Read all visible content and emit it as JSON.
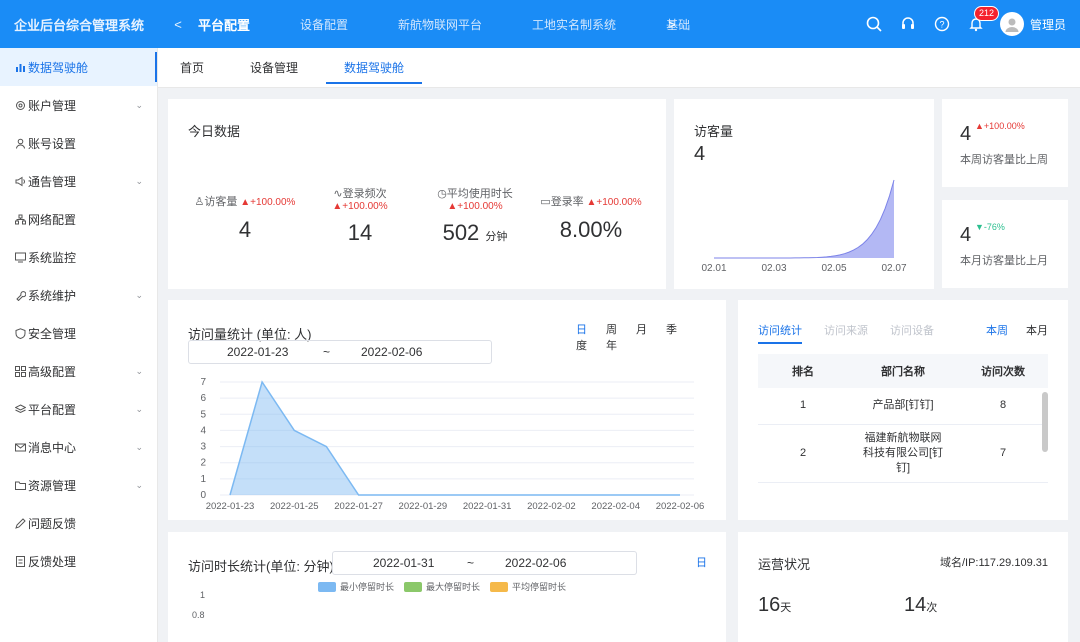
{
  "header": {
    "brand": "企业后台综合管理系统",
    "prev": "<",
    "next": ">",
    "nav": [
      "平台配置",
      "设备配置",
      "新航物联网平台",
      "工地实名制系统",
      "基础"
    ],
    "active_nav": 0,
    "notification_count": "212",
    "user_name": "管理员",
    "accent": "#1a8cf6"
  },
  "sidebar": {
    "items": [
      {
        "label": "数据驾驶舱",
        "icon": "bar-chart-icon",
        "active": true,
        "chevron": false
      },
      {
        "label": "账户管理",
        "icon": "gear-icon",
        "chevron": true
      },
      {
        "label": "账号设置",
        "icon": "user-icon",
        "chevron": false
      },
      {
        "label": "通告管理",
        "icon": "megaphone-icon",
        "chevron": true
      },
      {
        "label": "网络配置",
        "icon": "network-icon",
        "chevron": false
      },
      {
        "label": "系统监控",
        "icon": "monitor-icon",
        "chevron": false
      },
      {
        "label": "系统维护",
        "icon": "wrench-icon",
        "chevron": true
      },
      {
        "label": "安全管理",
        "icon": "shield-icon",
        "chevron": false
      },
      {
        "label": "高级配置",
        "icon": "grid-icon",
        "chevron": true
      },
      {
        "label": "平台配置",
        "icon": "layers-icon",
        "chevron": true
      },
      {
        "label": "消息中心",
        "icon": "mail-icon",
        "chevron": true
      },
      {
        "label": "资源管理",
        "icon": "folder-icon",
        "chevron": true
      },
      {
        "label": "问题反馈",
        "icon": "edit-icon",
        "chevron": false
      },
      {
        "label": "反馈处理",
        "icon": "document-icon",
        "chevron": false
      }
    ]
  },
  "tabs": [
    "首页",
    "设备管理",
    "数据驾驶舱"
  ],
  "today": {
    "title": "今日数据",
    "stats": [
      {
        "label": "访客量",
        "change": "+100.00%",
        "value": "4",
        "unit": ""
      },
      {
        "label": "登录频次",
        "change": "+100.00%",
        "value": "14",
        "unit": ""
      },
      {
        "label": "平均使用时长",
        "change": "+100.00%",
        "value": "502",
        "unit": "分钟"
      },
      {
        "label": "登录率",
        "change": "+100.00%",
        "value": "8.00%",
        "unit": ""
      }
    ]
  },
  "visitor": {
    "title": "访客量",
    "value": "4"
  },
  "mini_cards": [
    {
      "value": "4",
      "change": "+100.00%",
      "direction": "up",
      "desc": "本周访客量比上周"
    },
    {
      "value": "4",
      "change": "-76%",
      "direction": "down",
      "desc": "本月访客量比上月"
    }
  ],
  "visit_stats": {
    "title": "访问量统计 (单位: 人)",
    "range_start": "2022-01-23",
    "range_sep": "~",
    "range_end": "2022-02-06",
    "periods": [
      "日",
      "周",
      "月",
      "季",
      "度",
      "年"
    ]
  },
  "ranking": {
    "tabs": [
      "访问统计",
      "访问来源",
      "访问设备"
    ],
    "periods": [
      "本周",
      "本月"
    ],
    "headers": [
      "排名",
      "部门名称",
      "访问次数"
    ],
    "rows": [
      {
        "rank": "1",
        "dept": "产品部[钉钉]",
        "count": "8"
      },
      {
        "rank": "2",
        "dept": "福建新航物联网科技有限公司[钉钉]",
        "count": "7"
      }
    ]
  },
  "duration": {
    "title": "访问时长统计(单位: 分钟)",
    "range_start": "2022-01-31",
    "range_sep": "~",
    "range_end": "2022-02-06",
    "period": "日",
    "legend": [
      {
        "name": "最小停留时长",
        "color": "#7cb9f2"
      },
      {
        "name": "最大停留时长",
        "color": "#8bc86a"
      },
      {
        "name": "平均停留时长",
        "color": "#f5b94a"
      }
    ],
    "ticks": [
      "1",
      "0.8"
    ]
  },
  "ops": {
    "title": "运营状况",
    "domain": "域名/IP:117.29.109.31",
    "days": "16",
    "days_unit": "天",
    "times": "14",
    "times_unit": "次"
  },
  "chart_data": [
    {
      "type": "area",
      "x": [
        "02.01",
        "02.03",
        "02.05",
        "02.07"
      ],
      "values": [
        0,
        0,
        0,
        4
      ],
      "title": "",
      "color": "#9aa0f0"
    },
    {
      "type": "area",
      "categories": [
        "2022-01-23",
        "2022-01-24",
        "2022-01-25",
        "2022-01-26",
        "2022-01-27",
        "2022-01-28",
        "2022-01-29",
        "2022-01-30",
        "2022-01-31",
        "2022-02-01",
        "2022-02-02",
        "2022-02-03",
        "2022-02-04",
        "2022-02-05",
        "2022-02-06"
      ],
      "x_tick_labels": [
        "2022-01-23",
        "2022-01-25",
        "2022-01-27",
        "2022-01-29",
        "2022-01-31",
        "2022-02-02",
        "2022-02-04",
        "2022-02-06"
      ],
      "values": [
        0,
        7,
        4,
        3,
        0,
        0,
        0,
        0,
        0,
        0,
        0,
        0,
        0,
        0,
        0
      ],
      "ylim": [
        0,
        7
      ],
      "y_ticks": [
        0,
        1,
        2,
        3,
        4,
        5,
        6,
        7
      ],
      "grid": true,
      "color": "#7cb9f2"
    }
  ]
}
